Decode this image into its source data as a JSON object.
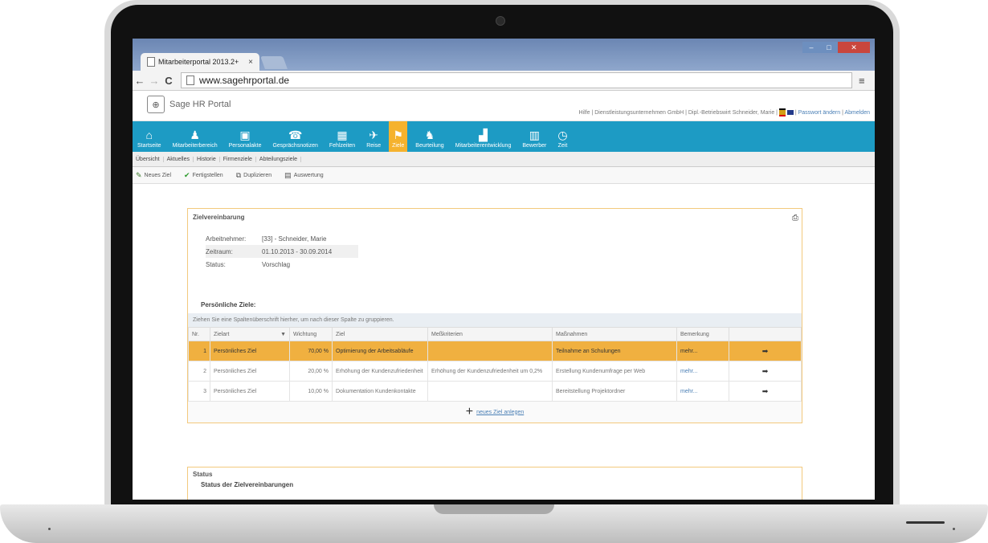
{
  "browser": {
    "tab_title": "Mitarbeiterportal 2013.2+",
    "tab_close": "×",
    "url": "www.sagehrportal.de",
    "nav_back": "←",
    "nav_forward": "→",
    "nav_reload": "C",
    "menu": "≡"
  },
  "portal": {
    "logo_text": "Sage HR Portal",
    "toplinks": {
      "help": "Hilfe",
      "company": "Dienstleistungsunternehmen GmbH",
      "user": "Dipl.-Betriebswirt Schneider, Marie",
      "password": "Passwort ändern",
      "logout": "Abmelden"
    }
  },
  "mainnav": [
    {
      "label": "Startseite",
      "icon": "⌂"
    },
    {
      "label": "Mitarbeiterbereich",
      "icon": "♟"
    },
    {
      "label": "Personalakte",
      "icon": "▣"
    },
    {
      "label": "Gesprächsnotizen",
      "icon": "☎"
    },
    {
      "label": "Fehlzeiten",
      "icon": "▦"
    },
    {
      "label": "Reise",
      "icon": "✈"
    },
    {
      "label": "Ziele",
      "icon": "⚑"
    },
    {
      "label": "Beurteilung",
      "icon": "♞"
    },
    {
      "label": "Mitarbeiterentwicklung",
      "icon": "▟"
    },
    {
      "label": "Bewerber",
      "icon": "▥"
    },
    {
      "label": "Zeit",
      "icon": "◷"
    }
  ],
  "subnav": [
    "Übersicht",
    "Aktuelles",
    "Historie",
    "Firmenziele",
    "Abteilungsziele"
  ],
  "toolbar": {
    "new": "Neues Ziel",
    "finish": "Fertigstellen",
    "duplicate": "Duplizieren",
    "evaluation": "Auswertung"
  },
  "panel": {
    "title": "Zielvereinbarung",
    "employee_label": "Arbeitnehmer:",
    "employee_value": "[33] - Schneider, Marie",
    "period_label": "Zeitraum:",
    "period_value": "01.10.2013 - 30.09.2014",
    "status_label": "Status:",
    "status_value": "Vorschlag",
    "personal_goals": "Persönliche Ziele:",
    "group_hint": "Ziehen Sie eine Spaltenüberschrift hierher, um nach dieser Spalte zu gruppieren.",
    "columns": [
      "Nr.",
      "Zielart",
      "Wichtung",
      "Ziel",
      "Meßkriterien",
      "Maßnahmen",
      "Bemerkung",
      ""
    ],
    "rows": [
      {
        "nr": "1",
        "type": "Persönliches Ziel",
        "weight": "70,00 %",
        "goal": "Optimierung der Arbeitsabläufe",
        "criteria": "",
        "measures": "Teilnahme an Schulungen",
        "remark": "mehr...",
        "arrow": "➡"
      },
      {
        "nr": "2",
        "type": "Persönliches Ziel",
        "weight": "20,00 %",
        "goal": "Erhöhung der Kundenzufriedenheit",
        "criteria": "Erhöhung der Kundenzufriedenheit um 0,2%",
        "measures": "Erstellung Kundenumfrage per Web",
        "remark": "mehr...",
        "arrow": "➡"
      },
      {
        "nr": "3",
        "type": "Persönliches Ziel",
        "weight": "10,00 %",
        "goal": "Dokumentation Kundenkontakte",
        "criteria": "",
        "measures": "Bereitstellung Projektordner",
        "remark": "mehr...",
        "arrow": "➡"
      }
    ],
    "add_goal": "neues Ziel anlegen"
  },
  "status_panel": {
    "title": "Status",
    "subtitle": "Status der Zielvereinbarungen"
  }
}
